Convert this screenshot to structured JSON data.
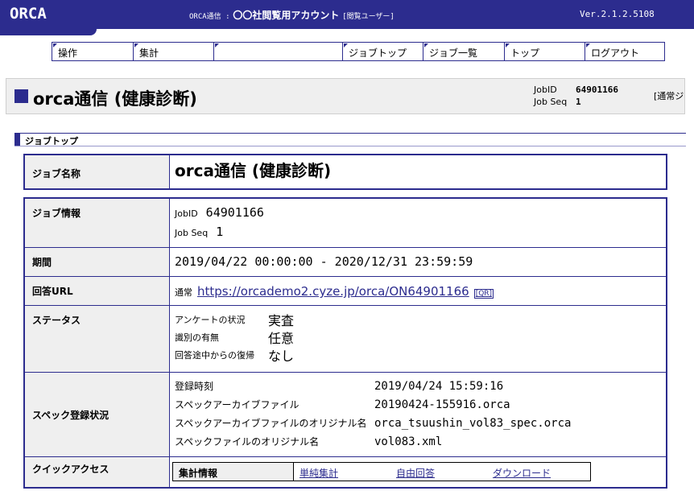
{
  "header": {
    "logo": "ORCA",
    "account_prefix": "ORCA通信 :",
    "account_name": "〇〇社閲覧用アカウント",
    "account_role": "[閲覧ユーザー]",
    "version": "Ver.2.1.2.5108"
  },
  "nav": {
    "items": [
      "操作",
      "集計",
      "",
      "ジョブトップ",
      "ジョブ一覧",
      "トップ",
      "ログアウト"
    ]
  },
  "title_bar": {
    "title": "orca通信 (健康診断)",
    "jobid_label": "JobID",
    "jobid": "64901166",
    "jobseq_label": "Job Seq",
    "jobseq": "1",
    "mode": "[通常ジョブ"
  },
  "section": {
    "label": "ジョブトップ"
  },
  "job_name": {
    "label": "ジョブ名称",
    "value": "orca通信 (健康診断)"
  },
  "details": {
    "job_info": {
      "label": "ジョブ情報",
      "jobid_label": "JobID",
      "jobid": "64901166",
      "jobseq_label": "Job Seq",
      "jobseq": "1"
    },
    "period": {
      "label": "期間",
      "value": "2019/04/22 00:00:00 - 2020/12/31 23:59:59"
    },
    "url": {
      "label": "回答URL",
      "prefix": "通常",
      "link": "https://orcademo2.cyze.jp/orca/ON64901166",
      "qr": "[QR]"
    },
    "status": {
      "label": "ステータス",
      "items": [
        {
          "k": "アンケートの状況",
          "v": "実査"
        },
        {
          "k": "識別の有無",
          "v": "任意"
        },
        {
          "k": "回答途中からの復帰",
          "v": "なし"
        }
      ]
    },
    "spec": {
      "label": "スペック登録状況",
      "items": [
        {
          "k": "登録時刻",
          "v": "2019/04/24 15:59:16"
        },
        {
          "k": "スペックアーカイブファイル",
          "v": "20190424-155916.orca"
        },
        {
          "k": "スペックアーカイブファイルのオリジナル名",
          "v": "orca_tsuushin_vol83_spec.orca"
        },
        {
          "k": "スペックファイルのオリジナル名",
          "v": "vol083.xml"
        }
      ]
    },
    "quick": {
      "label": "クイックアクセス",
      "group": "集計情報",
      "links": [
        "単純集計",
        "自由回答",
        "ダウンロード"
      ]
    }
  },
  "colors": {
    "primary": "#2c2c8e",
    "header_cell": "#efefef"
  }
}
